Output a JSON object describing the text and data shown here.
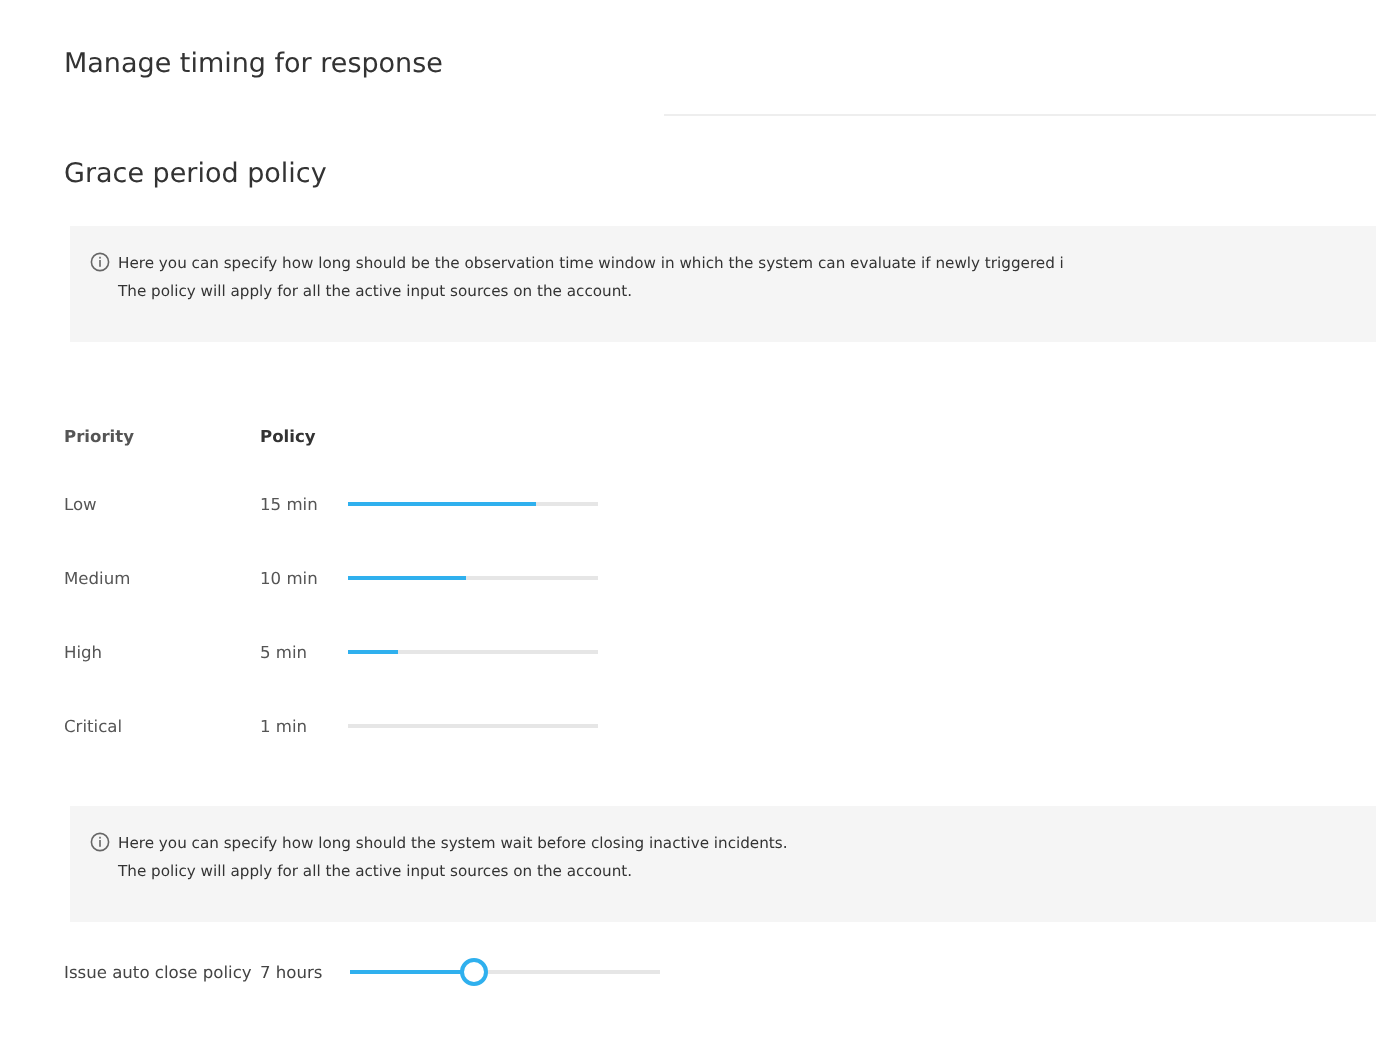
{
  "title": "Manage timing for response",
  "grace_section": {
    "title": "Grace period policy",
    "info": [
      "Here you can specify how long should be the observation time window in which the system can evaluate if newly triggered i",
      "The policy will apply for all the active input sources on the account."
    ]
  },
  "table": {
    "columns": [
      "Priority",
      "Policy"
    ],
    "rows": [
      {
        "priority": "Low",
        "value": "15 min",
        "level": 0.75
      },
      {
        "priority": "Medium",
        "value": "10 min",
        "level": 0.47
      },
      {
        "priority": "High",
        "value": "5 min",
        "level": 0.2
      },
      {
        "priority": "Critical",
        "value": "1 min",
        "level": 0
      }
    ]
  },
  "auto_close": {
    "info": [
      "Here you can specify how long should the system wait before closing inactive incidents.",
      "The policy will apply for all the active input sources on the account."
    ],
    "label": "Issue auto close policy",
    "value": "7 hours",
    "level": 0.4
  }
}
